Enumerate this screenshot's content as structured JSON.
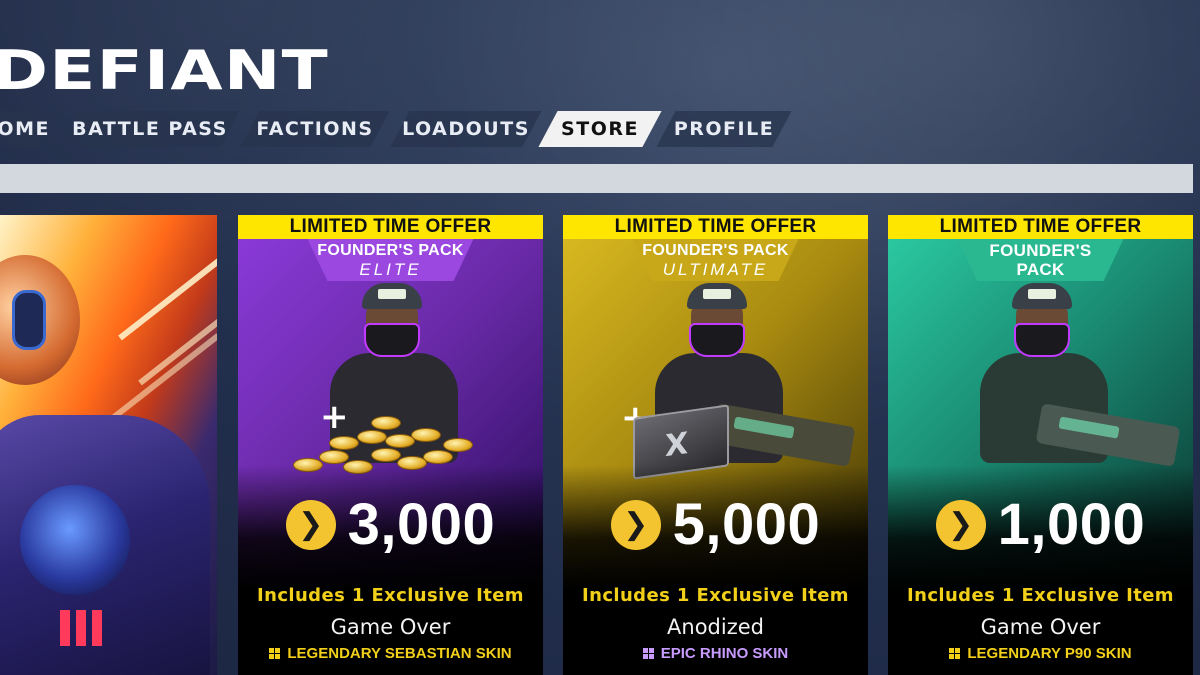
{
  "app": {
    "logo": "DEFIANT"
  },
  "nav": {
    "items": [
      {
        "label": "HOME",
        "active": false
      },
      {
        "label": "BATTLE PASS",
        "active": false
      },
      {
        "label": "FACTIONS",
        "active": false
      },
      {
        "label": "LOADOUTS",
        "active": false
      },
      {
        "label": "STORE",
        "active": true
      },
      {
        "label": "PROFILE",
        "active": false
      }
    ]
  },
  "hero": {
    "icon": "featured-character-art"
  },
  "colors": {
    "offer_banner": "#ffe600",
    "currency": "#f4c430",
    "includes_text": "#f2d01a",
    "legendary": "#f2d01a",
    "epic": "#c89cff"
  },
  "cards": [
    {
      "banner": "LIMITED TIME OFFER",
      "pack_title": "FOUNDER'S PACK",
      "pack_tier": "ELITE",
      "price": "3,000",
      "includes": "Includes 1 Exclusive Item",
      "item_name": "Game Over",
      "rarity_label": "LEGENDARY SEBASTIAN SKIN",
      "rarity": "legendary",
      "bonus": "coins",
      "theme": "#6a2aa8"
    },
    {
      "banner": "LIMITED TIME OFFER",
      "pack_title": "FOUNDER'S PACK",
      "pack_tier": "ULTIMATE",
      "price": "5,000",
      "includes": "Includes 1 Exclusive Item",
      "item_name": "Anodized",
      "rarity_label": "EPIC RHINO SKIN",
      "rarity": "epic",
      "bonus": "chest",
      "theme": "#b89a10"
    },
    {
      "banner": "LIMITED TIME OFFER",
      "pack_title": "FOUNDER'S",
      "pack_title_2": "PACK",
      "pack_tier": "",
      "price": "1,000",
      "includes": "Includes 1 Exclusive Item",
      "item_name": "Game Over",
      "rarity_label": "LEGENDARY P90 SKIN",
      "rarity": "legendary",
      "bonus": "none",
      "theme": "#1a8a72"
    }
  ]
}
